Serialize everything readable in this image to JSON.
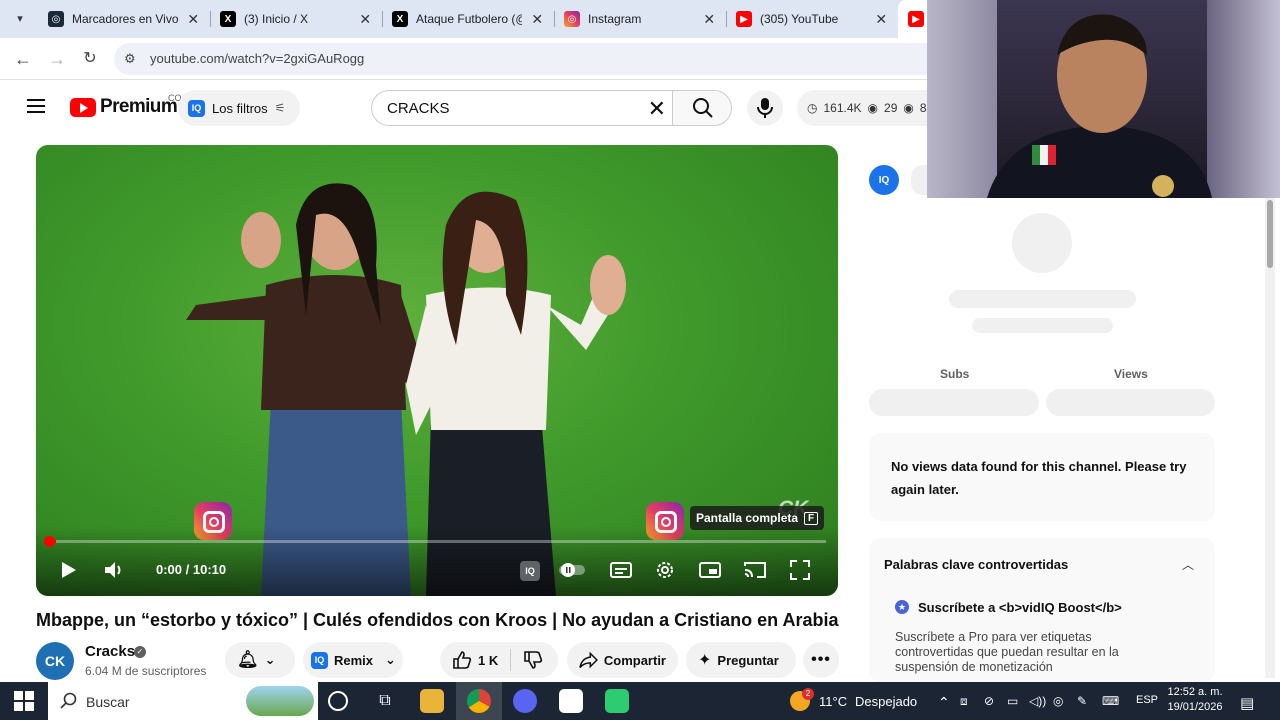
{
  "browser": {
    "tabs": [
      {
        "title": "Marcadores en Vivo",
        "favicon": "livescore-icon"
      },
      {
        "title": "(3) Inicio / X",
        "favicon": "x-icon"
      },
      {
        "title": "Ataque Futbolero (@",
        "favicon": "x-icon"
      },
      {
        "title": "Instagram",
        "favicon": "instagram-icon"
      },
      {
        "title": "(305) YouTube",
        "favicon": "youtube-icon"
      }
    ],
    "url": "youtube.com/watch?v=2gxiGAuRogg"
  },
  "header": {
    "brand": "Premium",
    "country_code": "CO",
    "filters_label": "Los filtros",
    "search_query": "CRACKS",
    "stats": {
      "views": "161.4K",
      "watching": "29",
      "extra": "8"
    }
  },
  "player": {
    "time": "0:00 / 10:10",
    "tooltip": "Pantalla completa",
    "tooltip_key": "F",
    "watermark": "CK",
    "progress_fraction": 0.01
  },
  "video": {
    "title": "Mbappe, un “estorbo y tóxico” | Culés ofendidos con Kroos | No ayudan a Cristiano en Arabia",
    "channel": "Cracks",
    "channel_initials": "CK",
    "subscribers": "6.04 M de suscriptores",
    "remix_label": "Remix",
    "likes": "1 K",
    "share_label": "Compartir",
    "ask_label": "Preguntar"
  },
  "panel": {
    "subs_label": "Subs",
    "views_label": "Views",
    "no_data": "No views data found for this channel. Please try again later.",
    "keywords_title": "Palabras clave controvertidas",
    "subscribe_title": "Suscríbete a <b>vidIQ Boost</b>",
    "subscribe_desc": "Suscríbete a Pro para ver etiquetas controvertidas que puedan resultar en la suspensión de monetización"
  },
  "taskbar": {
    "search_placeholder": "Buscar",
    "weather_badge": "2",
    "temperature": "11°C",
    "weather": "Despejado",
    "language": "ESP",
    "time": "12:52 a. m.",
    "date": "19/01/2026"
  }
}
